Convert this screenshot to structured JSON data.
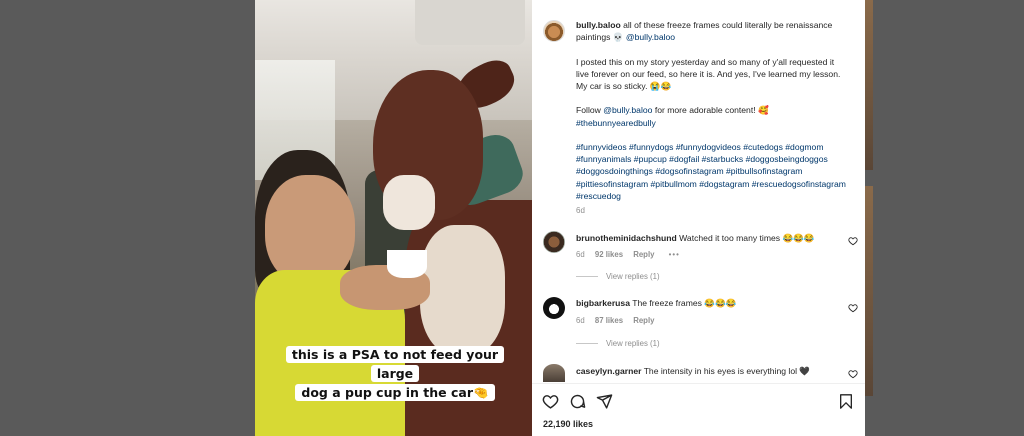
{
  "post": {
    "caption_user": "bully.baloo",
    "caption_line1": "all of these freeze frames could literally be renaissance paintings 💀",
    "caption_mention": "@bully.baloo",
    "para2": "I posted this on my story yesterday and so many of y'all requested it live forever on our feed, so here it is. And yes, I've learned my lesson. My car is so sticky. 😭😂",
    "para3_prefix": "Follow",
    "para3_mention": "@bully.baloo",
    "para3_suffix": "for more adorable content! 🥰",
    "para3_hashtag": "#thebunnyearedbully",
    "hashtags": "#funnyvideos #funnydogs #funnydogvideos #cutedogs #dogmom #funnyanimals #pupcup #dogfail #starbucks #doggosbeingdoggos #doggosdoingthings #dogsofinstagram #pitbullsofinstagram #pittiesofinstagram #pitbullmom #dogstagram #rescuedogsofinstagram #rescuedog",
    "time": "6d",
    "likes": "22,190 likes"
  },
  "video_caption": {
    "line1": "this is a PSA to not feed your large",
    "line2": "dog a pup cup in the car🤏"
  },
  "comments": [
    {
      "user": "brunotheminidachshund",
      "text": "Watched it too many times 😂😂😂",
      "time": "6d",
      "likes": "92 likes",
      "reply": "Reply",
      "more": "•••",
      "view_replies": "View replies (1)"
    },
    {
      "user": "bigbarkerusa",
      "text": "The freeze frames 😂😂😂",
      "time": "6d",
      "likes": "87 likes",
      "reply": "Reply",
      "view_replies": "View replies (1)"
    },
    {
      "user": "caseylyn.garner",
      "text": "The intensity in his eyes is everything lol 🖤"
    }
  ],
  "icons": {
    "like": "heart-icon",
    "comment": "comment-icon",
    "share": "share-icon",
    "save": "bookmark-icon"
  }
}
